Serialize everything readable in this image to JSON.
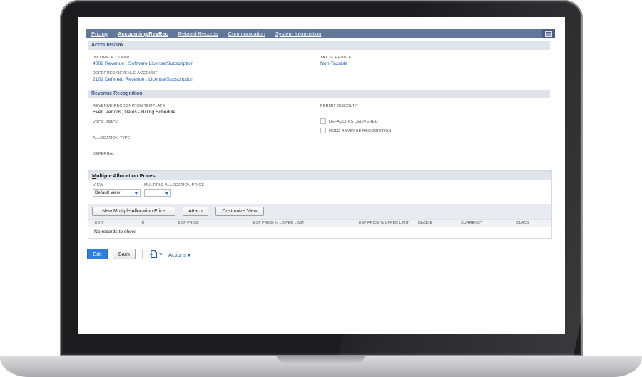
{
  "tabs": [
    {
      "label": "Pricing"
    },
    {
      "label": "Accounting/RevRec"
    },
    {
      "label": "Related Records"
    },
    {
      "label": "Communication"
    },
    {
      "label": "System Information"
    }
  ],
  "sections": {
    "accounts_tax": {
      "title": "Accounts/Tax",
      "income_account_label": "INCOME ACCOUNT",
      "income_account_value": "4002 Revenue : Software License/Subscription",
      "deferred_revenue_label": "DEFERRED REVENUE ACCOUNT",
      "deferred_revenue_value": "2102 Deferred Revenue : License/Subscription",
      "tax_schedule_label": "TAX SCHEDULE",
      "tax_schedule_value": "Non-Taxable"
    },
    "revenue_recognition": {
      "title": "Revenue Recognition",
      "template_label": "REVENUE RECOGNITION TEMPLATE",
      "template_value": "Even Periods, Dates - Billing Schedule",
      "vsoe_price_label": "VSOE PRICE",
      "allocation_type_label": "ALLOCATION TYPE",
      "deferral_label": "DEFERRAL",
      "permit_discount_label": "PERMIT DISCOUNT",
      "default_as_delivered_label": "DEFAULT AS DELIVERED",
      "hold_revenue_label": "HOLD REVENUE RECOGNITION"
    }
  },
  "sublist": {
    "title_first": "M",
    "title_rest": "ultiple Allocation Prices",
    "view_label": "VIEW",
    "view_value": "Default View",
    "map_label": "MULTIPLE ALLOCATION PRICE",
    "map_value": "",
    "buttons": {
      "new": "New Multiple Allocation Price",
      "attach": "Attach",
      "customize": "Customize View"
    },
    "columns": [
      "EDIT",
      "ID",
      "ESP PRICE",
      "ESP PRICE % LOWER LIMIT",
      "ESP PRICE % UPPER LIMIT",
      "ISVSOE",
      "CURRENCY",
      "CLASS"
    ],
    "empty_message": "No records to show."
  },
  "footer": {
    "edit_label": "Edit",
    "back_label": "Back",
    "actions_label": "Actions"
  },
  "colors": {
    "tab_bar": "#607799",
    "section_header_bg": "#dfe4eb",
    "section_header_text": "#3c5a84",
    "link": "#255ea8",
    "primary_button": "#2f7de0"
  }
}
